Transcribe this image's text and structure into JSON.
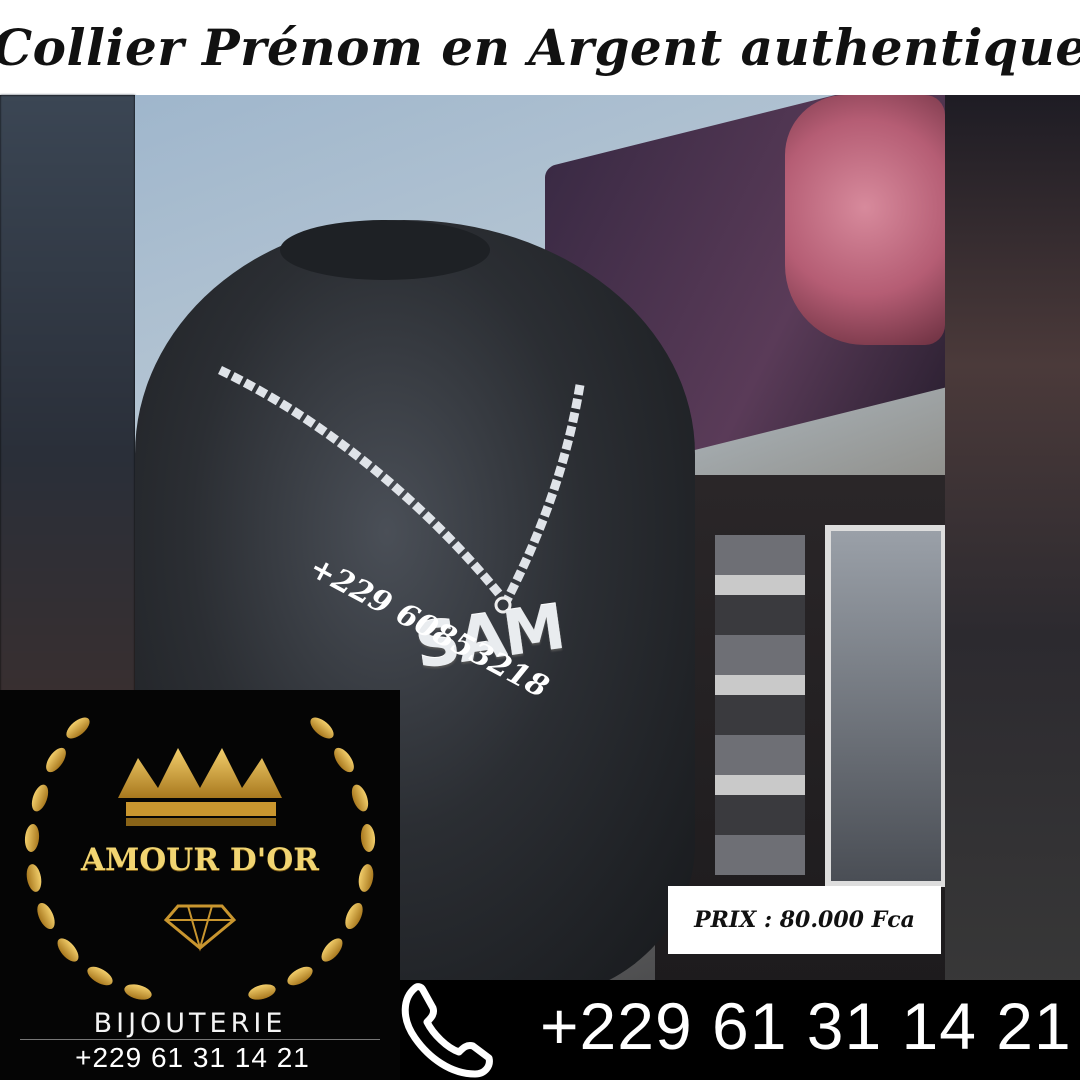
{
  "header": {
    "title": "Collier Prénom en Argent authentique"
  },
  "product": {
    "pendant_text": "SAM",
    "phone_overlay": "+229 60853218",
    "price": "PRIX : 80.000 Fca"
  },
  "logo": {
    "brand": "AMOUR D'OR",
    "subtitle": "BIJOUTERIE",
    "phone": "+229 61 31 14 21",
    "icons": [
      "crown-icon",
      "diamond-icon",
      "laurel-wreath"
    ]
  },
  "contact": {
    "phone": "+229 61 31 14 21",
    "icon": "phone-icon"
  },
  "colors": {
    "gold": "#d9a93a",
    "background": "#000000",
    "header_bg": "#ffffff"
  }
}
